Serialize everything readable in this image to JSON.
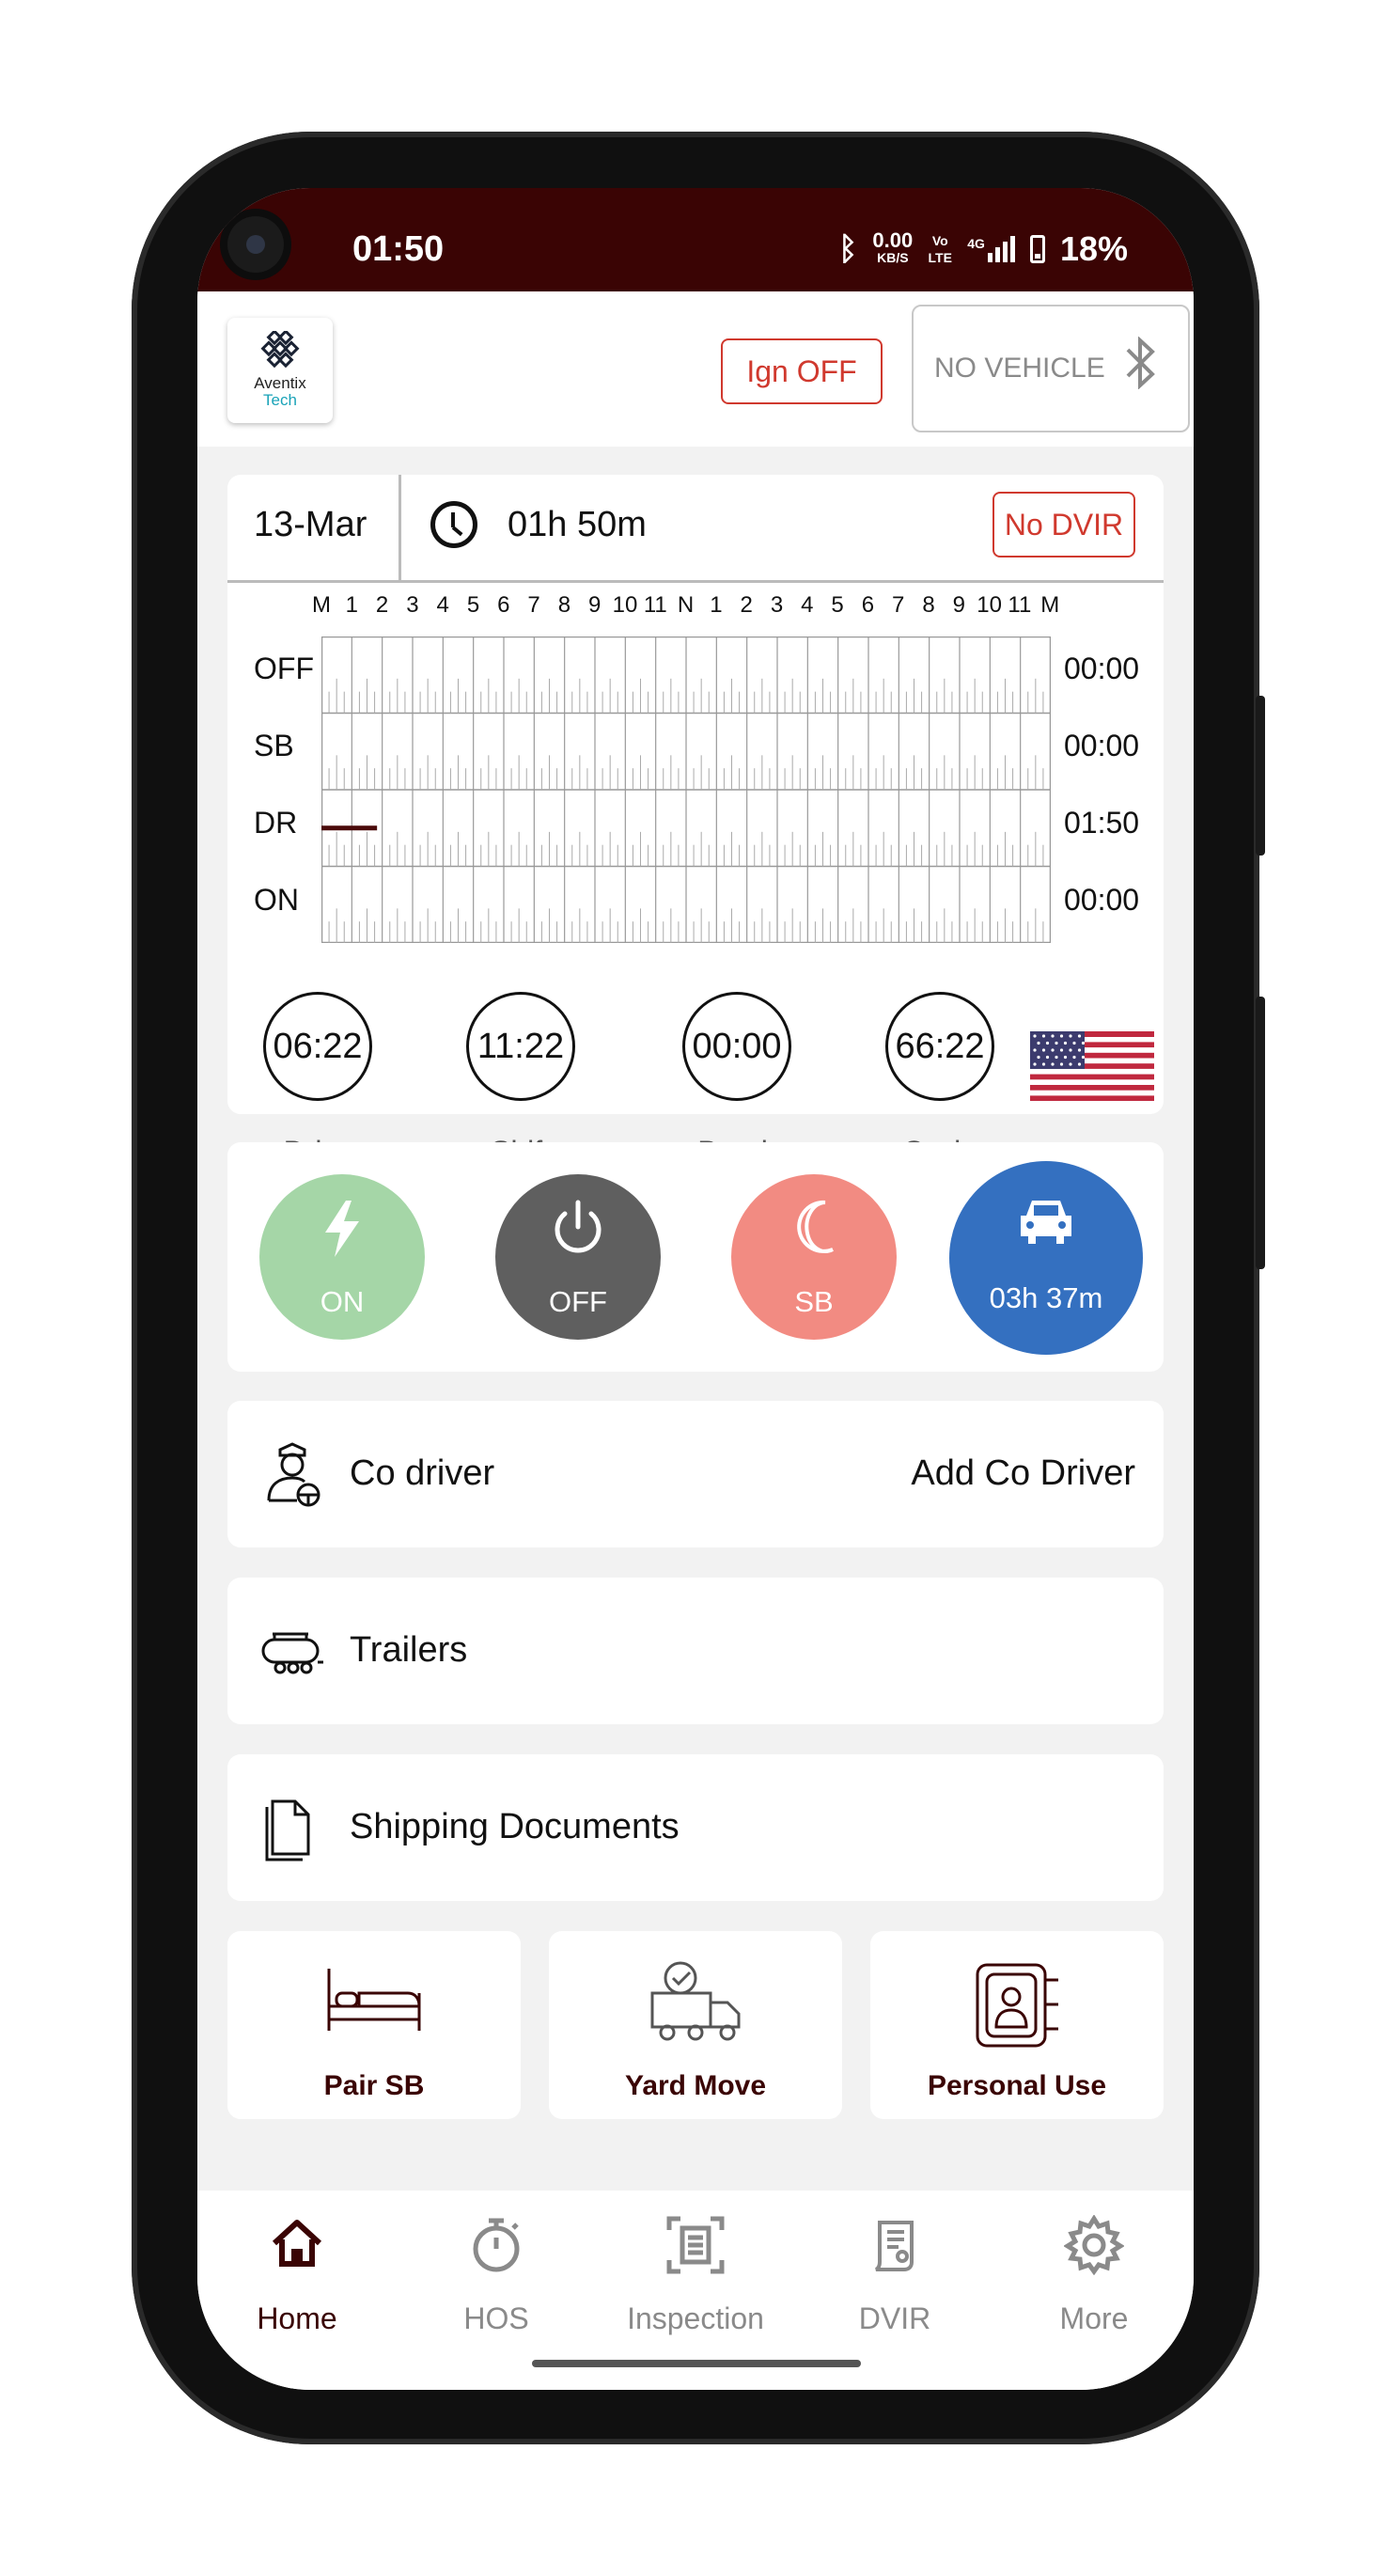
{
  "status_bar": {
    "time": "01:50",
    "data_rate": "0.00",
    "data_rate_unit": "KB/S",
    "volte": "Vo LTE",
    "network": "4G",
    "battery": "18%"
  },
  "header": {
    "logo_line1": "Aventix",
    "logo_line2": "Tech",
    "ign_label": "Ign OFF",
    "vehicle_label": "NO VEHICLE"
  },
  "log": {
    "date": "13-Mar",
    "elapsed": "01h 50m",
    "dvir_badge": "No DVIR",
    "hour_labels": [
      "M",
      "1",
      "2",
      "3",
      "4",
      "5",
      "6",
      "7",
      "8",
      "9",
      "10",
      "11",
      "N",
      "1",
      "2",
      "3",
      "4",
      "5",
      "6",
      "7",
      "8",
      "9",
      "10",
      "11",
      "M"
    ],
    "rows": [
      {
        "label": "OFF",
        "total": "00:00"
      },
      {
        "label": "SB",
        "total": "00:00"
      },
      {
        "label": "DR",
        "total": "01:50"
      },
      {
        "label": "ON",
        "total": "00:00"
      }
    ],
    "driving_segment_hours": [
      0,
      1.83
    ],
    "driving_color": "#4a0a0a"
  },
  "timers": [
    {
      "value": "06:22",
      "label": "Drive"
    },
    {
      "value": "11:22",
      "label": "Shift"
    },
    {
      "value": "00:00",
      "label": "Break"
    },
    {
      "value": "66:22",
      "label": "Cycle"
    }
  ],
  "duty_status": {
    "on": {
      "label": "ON",
      "color": "#a5d6a7"
    },
    "off": {
      "label": "OFF",
      "color": "#5f5f5f"
    },
    "sb": {
      "label": "SB",
      "color": "#f28b82"
    },
    "driving": {
      "label": "03h 37m",
      "color": "#3470c0"
    }
  },
  "rows": {
    "co_driver": {
      "label": "Co driver",
      "action": "Add Co Driver"
    },
    "trailers": {
      "label": "Trailers"
    },
    "shipping": {
      "label": "Shipping Documents"
    }
  },
  "tiles": [
    {
      "label": "Pair SB"
    },
    {
      "label": "Yard Move"
    },
    {
      "label": "Personal Use"
    }
  ],
  "nav": {
    "items": [
      {
        "label": "Home",
        "icon": "home-icon",
        "active": true
      },
      {
        "label": "HOS",
        "icon": "stopwatch-icon",
        "active": false
      },
      {
        "label": "Inspection",
        "icon": "inspection-icon",
        "active": false
      },
      {
        "label": "DVIR",
        "icon": "dvir-icon",
        "active": false
      },
      {
        "label": "More",
        "icon": "gear-icon",
        "active": false
      }
    ],
    "active_color": "#3a0404"
  }
}
